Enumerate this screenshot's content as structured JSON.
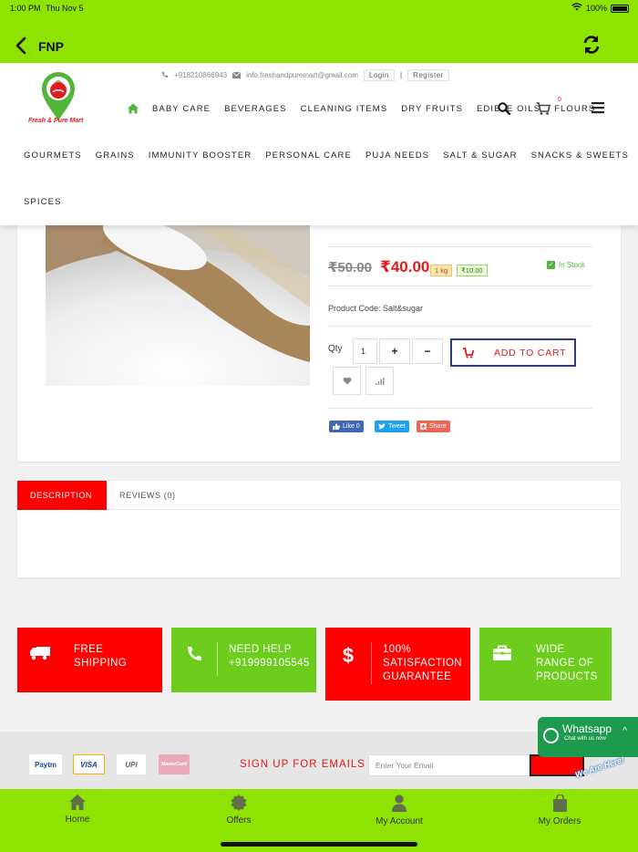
{
  "status_bar": {
    "time": "1:00 PM",
    "date": "Thu Nov 5",
    "battery": "100%"
  },
  "app_bar": {
    "title": "FNP"
  },
  "header": {
    "logo_text": "Fresh & Pure Mart",
    "phone": "+918210866943",
    "email": "info.freshandpuremart@gmail.com",
    "login_label": "Login",
    "separator": "|",
    "register_label": "Register",
    "cart_count": "0",
    "nav_row1": [
      "BABY CARE",
      "BEVERAGES",
      "CLEANING ITEMS",
      "DRY FRUITS",
      "EDIBLE OILS",
      "FLOURS"
    ],
    "nav_row2": [
      "GOURMETS",
      "GRAINS",
      "IMMUNITY BOOSTER",
      "PERSONAL CARE",
      "PUJA NEEDS",
      "SALT & SUGAR",
      "SNACKS & SWEETS"
    ],
    "nav_row3": [
      "SPICES"
    ]
  },
  "product": {
    "old_price": "₹50.00",
    "new_price": "₹40.00",
    "unit": "1 kg",
    "savings": "₹10.00",
    "stock": "In Stock",
    "code": "Product Code: Salt&sugar",
    "qty_label": "Qty",
    "qty_value": "1",
    "plus": "+",
    "minus": "−",
    "add_to_cart": "ADD TO CART",
    "share": {
      "like": "Like 0",
      "tweet": "Tweet",
      "share": "Share"
    }
  },
  "tabs": [
    {
      "label": "DESCRIPTION",
      "active": true
    },
    {
      "label": "REVIEWS (0)",
      "active": false
    }
  ],
  "features": [
    {
      "icon": "truck-icon",
      "lines": [
        "FREE",
        "SHIPPING"
      ],
      "color": "#ff0000"
    },
    {
      "icon": "phone-icon",
      "lines": [
        "NEED HELP",
        "+919999105545"
      ],
      "color": "#6ccd1c"
    },
    {
      "icon": "dollar-icon",
      "lines": [
        "100%",
        "SATISFACTION",
        "GUARANTEE"
      ],
      "color": "#ff0000"
    },
    {
      "icon": "briefcase-icon",
      "lines": [
        "WIDE",
        "RANGE OF",
        "PRODUCTS"
      ],
      "color": "#6ccd1c"
    }
  ],
  "footer": {
    "payments": [
      "Paytm",
      "VISA",
      "UPI",
      "MasterCard"
    ],
    "signup_label": "SIGN UP FOR EMAILS",
    "email_placeholder": "Enter Your Email",
    "whatsapp_title": "Whatsapp",
    "whatsapp_sub": "Chat with us now",
    "we_are_here": "We Are Here!"
  },
  "bottom_tabs": [
    {
      "label": "Home",
      "icon": "home-icon"
    },
    {
      "label": "Offers",
      "icon": "offers-icon"
    },
    {
      "label": "My Account",
      "icon": "account-icon"
    },
    {
      "label": "My Orders",
      "icon": "orders-icon"
    }
  ],
  "colors": {
    "brand_green": "#8ee300",
    "accent_red": "#ff0000",
    "feature_green": "#6ccd1c",
    "navy": "#303c82"
  }
}
